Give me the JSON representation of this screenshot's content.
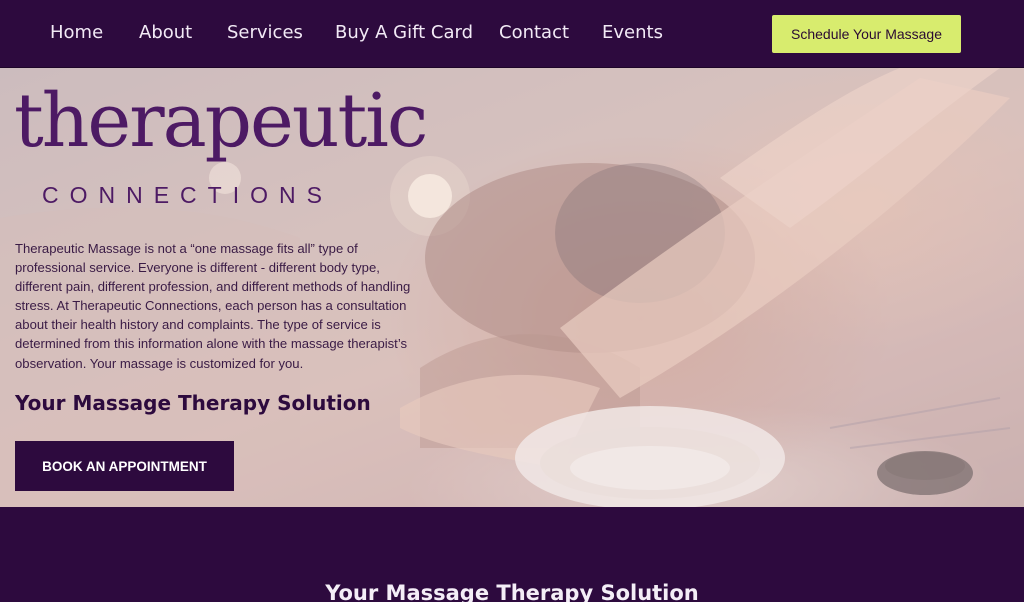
{
  "nav": {
    "links": [
      "Home",
      "About",
      "Services",
      "Buy A Gift Card",
      "Contact",
      "Events"
    ],
    "cta_label": "Schedule Your Massage"
  },
  "hero": {
    "logo": {
      "wordmark": "therapeutic",
      "subtitle": "CONNECTIONS"
    },
    "description": "Therapeutic Massage is not a “one massage fits all” type of professional service. Everyone is different - different body type, different pain, different profession, and different methods of handling stress. At Therapeutic Connections, each person has a consultation about their health history and complaints. The type of service is determined from this information alone with the massage therapist’s observation. Your massage is customized for you.",
    "heading": "Your Massage Therapy Solution",
    "button_label": "BOOK AN APPOINTMENT"
  },
  "section": {
    "heading": "Your Massage Therapy Solution"
  },
  "colors": {
    "brand_purple": "#2d0a3e",
    "logo_purple": "#4d1a64",
    "cta_green": "#d8ec6e"
  }
}
